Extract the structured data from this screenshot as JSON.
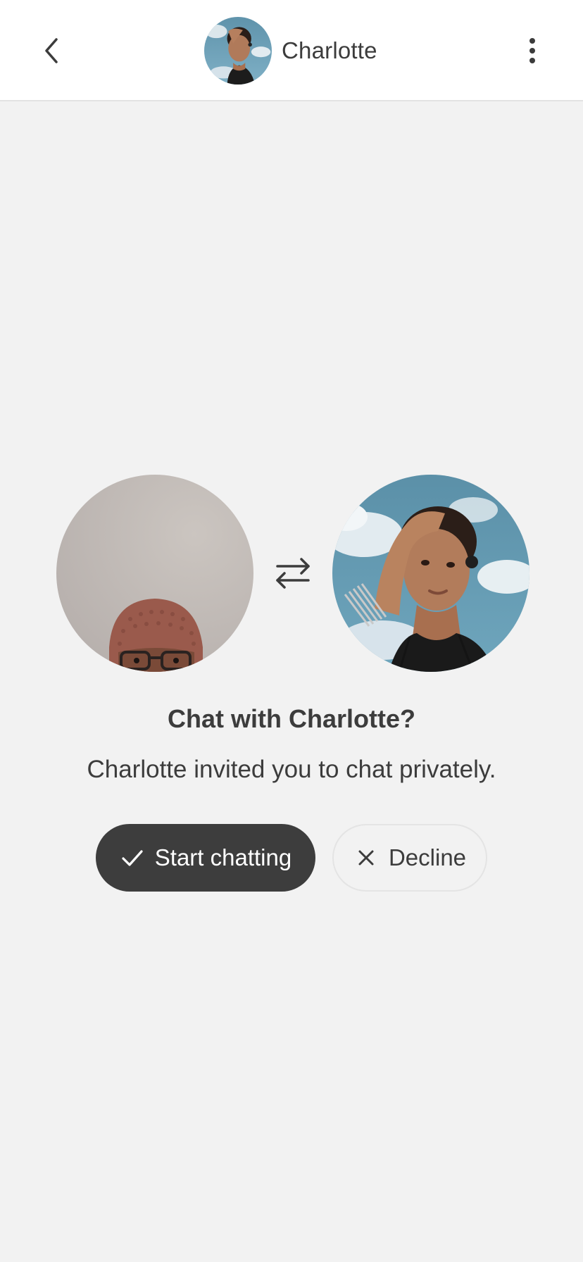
{
  "header": {
    "contact_name": "Charlotte",
    "back_icon": "chevron-left-icon",
    "menu_icon": "more-vertical-icon"
  },
  "invite": {
    "title": "Chat with Charlotte?",
    "subtitle": "Charlotte invited you to chat privately.",
    "swap_icon": "swap-arrows-icon"
  },
  "actions": {
    "accept_label": "Start chatting",
    "accept_icon": "check-icon",
    "decline_label": "Decline",
    "decline_icon": "close-icon"
  },
  "colors": {
    "background": "#f2f2f2",
    "header_background": "#ffffff",
    "primary_button": "#3d3d3d",
    "text": "#3c3c3c"
  }
}
